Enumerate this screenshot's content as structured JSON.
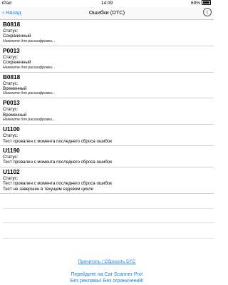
{
  "status_bar": {
    "carrier": "iPad",
    "time": "14:09",
    "battery": "69%"
  },
  "navbar": {
    "back_label": "Назад",
    "title": "Ошибки (DTC)",
    "info_glyph": "i"
  },
  "dtc_list": [
    {
      "code": "B0818",
      "status_label": "Статус:",
      "status_lines": [
        "Сохраненный"
      ],
      "hint": "Нажмите для расшифровки..."
    },
    {
      "code": "P0013",
      "status_label": "Статус:",
      "status_lines": [
        "Сохраненный"
      ],
      "hint": "Нажмите для расшифровки..."
    },
    {
      "code": "B0818",
      "status_label": "Статус:",
      "status_lines": [
        "Временный"
      ],
      "hint": "Нажмите для расшифровки..."
    },
    {
      "code": "P0013",
      "status_label": "Статус:",
      "status_lines": [
        "Временный"
      ],
      "hint": "Нажмите для расшифровки..."
    },
    {
      "code": "U1100",
      "status_label": "Статус:",
      "status_lines": [
        "Тест провален с момента последнего сброса ошибок"
      ],
      "hint": ""
    },
    {
      "code": "U1190",
      "status_label": "Статус:",
      "status_lines": [
        "Тест провален с момента последнего сброса ошибок"
      ],
      "hint": ""
    },
    {
      "code": "U1102",
      "status_label": "Статус:",
      "status_lines": [
        "Тест провален с момента последнего сброса ошибок",
        "Тест не завершен в текущем ездовом цикле"
      ],
      "hint": ""
    }
  ],
  "footer": {
    "read_reset_label": "Прочитать / Сбросить DTC",
    "promo_line1": "Перейдите на Car Scanner Pro!",
    "promo_line2": "Без рекламы! Без ограничений!"
  },
  "colors": {
    "accent": "#1a82e2",
    "separator": "#d0d0d4"
  }
}
